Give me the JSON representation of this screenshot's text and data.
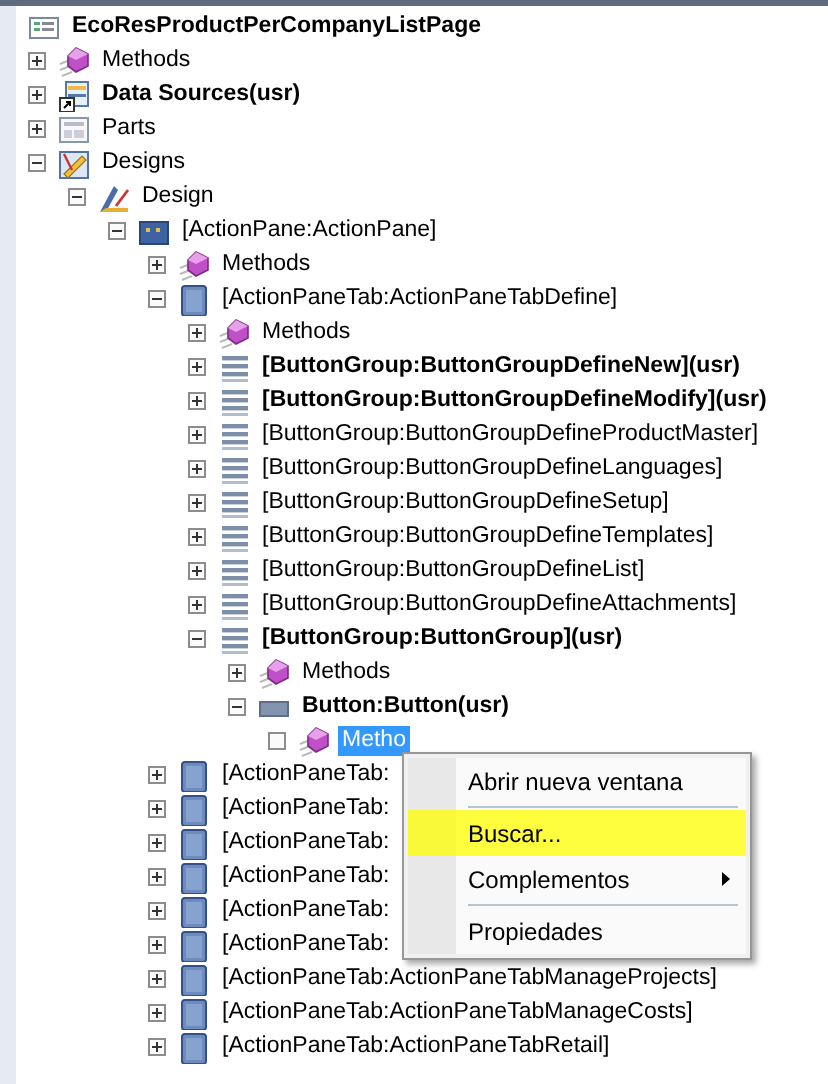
{
  "tree": [
    {
      "label": "EcoResProductPerCompanyListPage",
      "kind": "form",
      "bold": true,
      "children": [
        {
          "label": "Methods",
          "kind": "methods",
          "bold": false,
          "expanded": false
        },
        {
          "label": "Data Sources(usr)",
          "kind": "datasources",
          "bold": true,
          "expanded": false
        },
        {
          "label": "Parts",
          "kind": "parts",
          "bold": false,
          "expanded": false
        },
        {
          "label": "Designs",
          "kind": "designs",
          "bold": false,
          "expanded": true,
          "children": [
            {
              "label": "Design",
              "kind": "design",
              "bold": false,
              "expanded": true,
              "children": [
                {
                  "label": "[ActionPane:ActionPane]",
                  "kind": "actionpane",
                  "bold": false,
                  "expanded": true,
                  "children": [
                    {
                      "label": "Methods",
                      "kind": "methods",
                      "bold": false,
                      "expanded": false
                    },
                    {
                      "label": "[ActionPaneTab:ActionPaneTabDefine]",
                      "kind": "tab",
                      "bold": false,
                      "expanded": true,
                      "children": [
                        {
                          "label": "Methods",
                          "kind": "methods",
                          "bold": false,
                          "expanded": false
                        },
                        {
                          "label": "[ButtonGroup:ButtonGroupDefineNew](usr)",
                          "kind": "buttongroup",
                          "bold": true,
                          "expanded": false
                        },
                        {
                          "label": "[ButtonGroup:ButtonGroupDefineModify](usr)",
                          "kind": "buttongroup",
                          "bold": true,
                          "expanded": false
                        },
                        {
                          "label": "[ButtonGroup:ButtonGroupDefineProductMaster]",
                          "kind": "buttongroup",
                          "bold": false,
                          "expanded": false
                        },
                        {
                          "label": "[ButtonGroup:ButtonGroupDefineLanguages]",
                          "kind": "buttongroup",
                          "bold": false,
                          "expanded": false
                        },
                        {
                          "label": "[ButtonGroup:ButtonGroupDefineSetup]",
                          "kind": "buttongroup",
                          "bold": false,
                          "expanded": false
                        },
                        {
                          "label": "[ButtonGroup:ButtonGroupDefineTemplates]",
                          "kind": "buttongroup",
                          "bold": false,
                          "expanded": false
                        },
                        {
                          "label": "[ButtonGroup:ButtonGroupDefineList]",
                          "kind": "buttongroup",
                          "bold": false,
                          "expanded": false
                        },
                        {
                          "label": "[ButtonGroup:ButtonGroupDefineAttachments]",
                          "kind": "buttongroup",
                          "bold": false,
                          "expanded": false
                        },
                        {
                          "label": "[ButtonGroup:ButtonGroup](usr)",
                          "kind": "buttongroup",
                          "bold": true,
                          "expanded": true,
                          "children": [
                            {
                              "label": "Methods",
                              "kind": "methods",
                              "bold": false,
                              "expanded": false
                            },
                            {
                              "label": "Button:Button(usr)",
                              "kind": "button",
                              "bold": true,
                              "expanded": true,
                              "children": [
                                {
                                  "label": "Metho",
                                  "kind": "methods",
                                  "bold": false,
                                  "selected": true
                                }
                              ]
                            }
                          ]
                        }
                      ]
                    },
                    {
                      "label": "[ActionPaneTab:",
                      "kind": "tab",
                      "bold": false,
                      "expanded": false
                    },
                    {
                      "label": "[ActionPaneTab:",
                      "kind": "tab",
                      "bold": false,
                      "expanded": false
                    },
                    {
                      "label": "[ActionPaneTab:",
                      "kind": "tab",
                      "bold": false,
                      "expanded": false
                    },
                    {
                      "label": "[ActionPaneTab:",
                      "kind": "tab",
                      "bold": false,
                      "expanded": false
                    },
                    {
                      "label": "[ActionPaneTab:",
                      "kind": "tab",
                      "bold": false,
                      "expanded": false
                    },
                    {
                      "label": "[ActionPaneTab:",
                      "kind": "tab",
                      "bold": false,
                      "expanded": false
                    },
                    {
                      "label": "[ActionPaneTab:ActionPaneTabManageProjects]",
                      "kind": "tab",
                      "bold": false,
                      "expanded": false
                    },
                    {
                      "label": "[ActionPaneTab:ActionPaneTabManageCosts]",
                      "kind": "tab",
                      "bold": false,
                      "expanded": false
                    },
                    {
                      "label": "[ActionPaneTab:ActionPaneTabRetail]",
                      "kind": "tab",
                      "bold": false,
                      "expanded": false
                    }
                  ]
                }
              ]
            }
          ]
        }
      ]
    }
  ],
  "context_menu": {
    "items": [
      {
        "label": "Abrir nueva ventana",
        "submenu": false,
        "separator_after": true
      },
      {
        "label": "Buscar...",
        "submenu": false,
        "separator_after": false,
        "marker_highlight": true
      },
      {
        "label": "Complementos",
        "submenu": true,
        "separator_after": true
      },
      {
        "label": "Propiedades",
        "submenu": false
      }
    ]
  }
}
